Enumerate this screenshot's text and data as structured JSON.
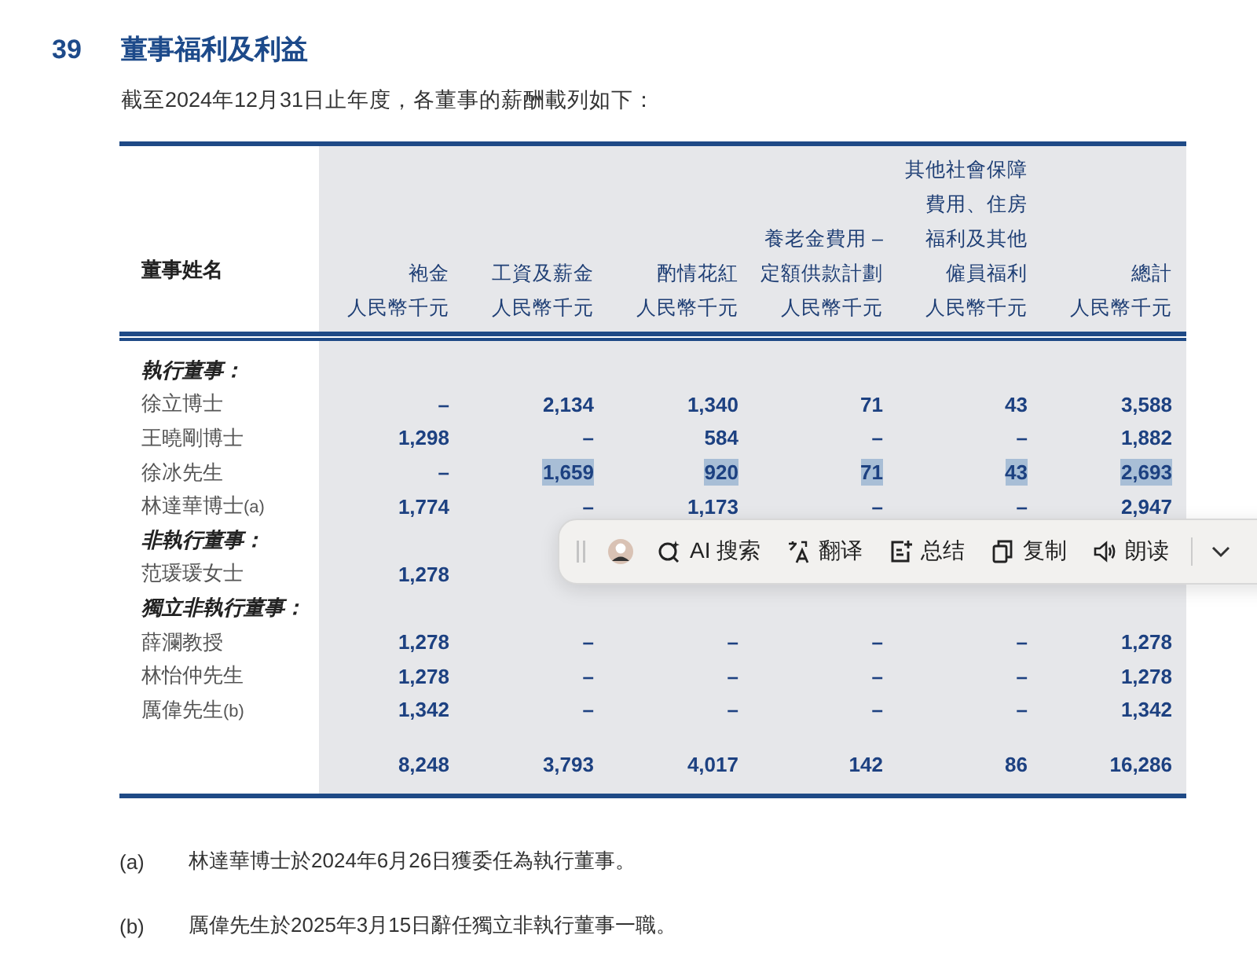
{
  "section": {
    "number": "39",
    "title": "董事福利及利益",
    "intro": "截至2024年12月31日止年度，各董事的薪酬載列如下："
  },
  "table": {
    "name_column": "董事姓名",
    "columns": [
      {
        "lines": [
          "袍金"
        ],
        "unit": "人民幣千元"
      },
      {
        "lines": [
          "工資及薪金"
        ],
        "unit": "人民幣千元"
      },
      {
        "lines": [
          "酌情花紅"
        ],
        "unit": "人民幣千元"
      },
      {
        "lines": [
          "養老金費用 –",
          "定額供款計劃"
        ],
        "unit": "人民幣千元"
      },
      {
        "lines": [
          "其他社會保障",
          "費用、住房",
          "福利及其他",
          "僱員福利"
        ],
        "unit": "人民幣千元"
      },
      {
        "lines": [
          "總計"
        ],
        "unit": "人民幣千元"
      }
    ],
    "rows": [
      {
        "kind": "section",
        "name": "執行董事："
      },
      {
        "kind": "director",
        "name": "徐立博士",
        "cells": [
          {
            "text": "–",
            "selected": false
          },
          {
            "text": "2,134",
            "selected": false
          },
          {
            "text": "1,340",
            "selected": false
          },
          {
            "text": "71",
            "selected": false
          },
          {
            "text": "43",
            "selected": false
          },
          {
            "text": "3,588",
            "selected": false
          }
        ]
      },
      {
        "kind": "director",
        "name": "王曉剛博士",
        "cells": [
          {
            "text": "1,298",
            "selected": false
          },
          {
            "text": "–",
            "selected": false
          },
          {
            "text": "584",
            "selected": false
          },
          {
            "text": "–",
            "selected": false
          },
          {
            "text": "–",
            "selected": false
          },
          {
            "text": "1,882",
            "selected": false
          }
        ]
      },
      {
        "kind": "director",
        "name": "徐冰先生",
        "cells": [
          {
            "text": "–",
            "selected": false
          },
          {
            "text": "1,659",
            "selected": true
          },
          {
            "text": "920",
            "selected": true
          },
          {
            "text": "71",
            "selected": true
          },
          {
            "text": "43",
            "selected": true
          },
          {
            "text": "2,693",
            "selected": true
          }
        ]
      },
      {
        "kind": "director",
        "name": "林達華博士",
        "note": "(a)",
        "cells": [
          {
            "text": "1,774",
            "selected": false
          },
          {
            "text": "–",
            "selected": false
          },
          {
            "text": "1,173",
            "selected": false
          },
          {
            "text": "–",
            "selected": false
          },
          {
            "text": "–",
            "selected": false
          },
          {
            "text": "2,947",
            "selected": false
          }
        ]
      },
      {
        "kind": "section",
        "name": "非執行董事："
      },
      {
        "kind": "director",
        "name": "范瑗瑗女士",
        "cells": [
          {
            "text": "1,278",
            "selected": false
          },
          null,
          null,
          null,
          null,
          null
        ]
      },
      {
        "kind": "section",
        "name": "獨立非執行董事："
      },
      {
        "kind": "director",
        "name": "薛瀾教授",
        "cells": [
          {
            "text": "1,278",
            "selected": false
          },
          {
            "text": "–",
            "selected": false
          },
          {
            "text": "–",
            "selected": false
          },
          {
            "text": "–",
            "selected": false
          },
          {
            "text": "–",
            "selected": false
          },
          {
            "text": "1,278",
            "selected": false
          }
        ]
      },
      {
        "kind": "director",
        "name": "林怡仲先生",
        "cells": [
          {
            "text": "1,278",
            "selected": false
          },
          {
            "text": "–",
            "selected": false
          },
          {
            "text": "–",
            "selected": false
          },
          {
            "text": "–",
            "selected": false
          },
          {
            "text": "–",
            "selected": false
          },
          {
            "text": "1,278",
            "selected": false
          }
        ]
      },
      {
        "kind": "director",
        "name": "厲偉先生",
        "note": "(b)",
        "cells": [
          {
            "text": "1,342",
            "selected": false
          },
          {
            "text": "–",
            "selected": false
          },
          {
            "text": "–",
            "selected": false
          },
          {
            "text": "–",
            "selected": false
          },
          {
            "text": "–",
            "selected": false
          },
          {
            "text": "1,342",
            "selected": false
          }
        ]
      }
    ],
    "totals": [
      "8,248",
      "3,793",
      "4,017",
      "142",
      "86",
      "16,286"
    ]
  },
  "footnotes": [
    {
      "mark": "(a)",
      "text": "林達華博士於2024年6月26日獲委任為執行董事。"
    },
    {
      "mark": "(b)",
      "text": "厲偉先生於2025年3月15日辭任獨立非執行董事一職。"
    }
  ],
  "selection_toolbar": {
    "tools": [
      {
        "label": "AI 搜索"
      },
      {
        "label": "翻译"
      },
      {
        "label": "总结"
      },
      {
        "label": "复制"
      },
      {
        "label": "朗读"
      }
    ]
  }
}
